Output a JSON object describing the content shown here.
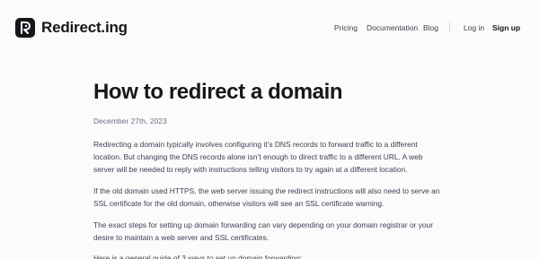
{
  "header": {
    "brand": "Redirect.ing",
    "nav": {
      "pricing": "Pricing",
      "documentation": "Documentation",
      "blog": "Blog",
      "login": "Log in",
      "signup": "Sign up"
    }
  },
  "article": {
    "title": "How to redirect a domain",
    "date": "December 27th, 2023",
    "paragraphs": [
      {
        "lines": [
          "Redirecting a domain typically involves configuring it’s DNS records to forward traffic to a different",
          "location. But changing the DNS records alone isn’t enough to direct traffic to a different URL. A web",
          "server will be needed to reply with instructions telling visitors to try again at a different location."
        ]
      },
      {
        "lines": [
          "If the old domain used HTTPS, the web server issuing the redirect instructions will also need to serve an",
          "SSL certificate for the old domain, otherwise visitors will see an SSL certificate warning."
        ]
      },
      {
        "lines": [
          "The exact steps for setting up domain forwarding can vary depending on your domain registrar or your",
          "desire to maintain a web server and SSL certificates."
        ]
      },
      {
        "lines": [
          "Here is a general guide of 3 ways to set up domain forwarding:"
        ]
      }
    ]
  },
  "colors": {
    "background": "#fbfbfc",
    "brand_dark": "#15171a",
    "body_text": "#3b4250",
    "muted": "#687385"
  }
}
